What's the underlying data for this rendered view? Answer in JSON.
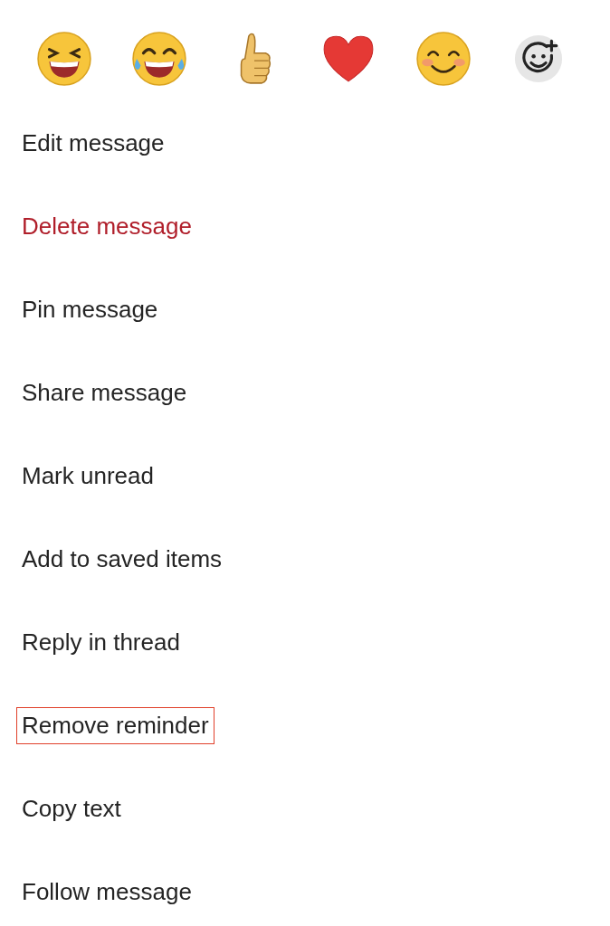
{
  "reactions": [
    {
      "kind": "laughing"
    },
    {
      "kind": "tears-of-joy"
    },
    {
      "kind": "thumbs-up"
    },
    {
      "kind": "heart"
    },
    {
      "kind": "smiling"
    },
    {
      "kind": "add-reaction"
    }
  ],
  "menu_items": [
    {
      "label": "Edit message",
      "kind": "normal",
      "highlighted": false
    },
    {
      "label": "Delete message",
      "kind": "destructive",
      "highlighted": false
    },
    {
      "label": "Pin message",
      "kind": "normal",
      "highlighted": false
    },
    {
      "label": "Share message",
      "kind": "normal",
      "highlighted": false
    },
    {
      "label": "Mark unread",
      "kind": "normal",
      "highlighted": false
    },
    {
      "label": "Add to saved items",
      "kind": "normal",
      "highlighted": false
    },
    {
      "label": "Reply in thread",
      "kind": "normal",
      "highlighted": false
    },
    {
      "label": "Remove reminder",
      "kind": "normal",
      "highlighted": true
    },
    {
      "label": "Copy text",
      "kind": "normal",
      "highlighted": false
    },
    {
      "label": "Follow message",
      "kind": "normal",
      "highlighted": false
    }
  ]
}
